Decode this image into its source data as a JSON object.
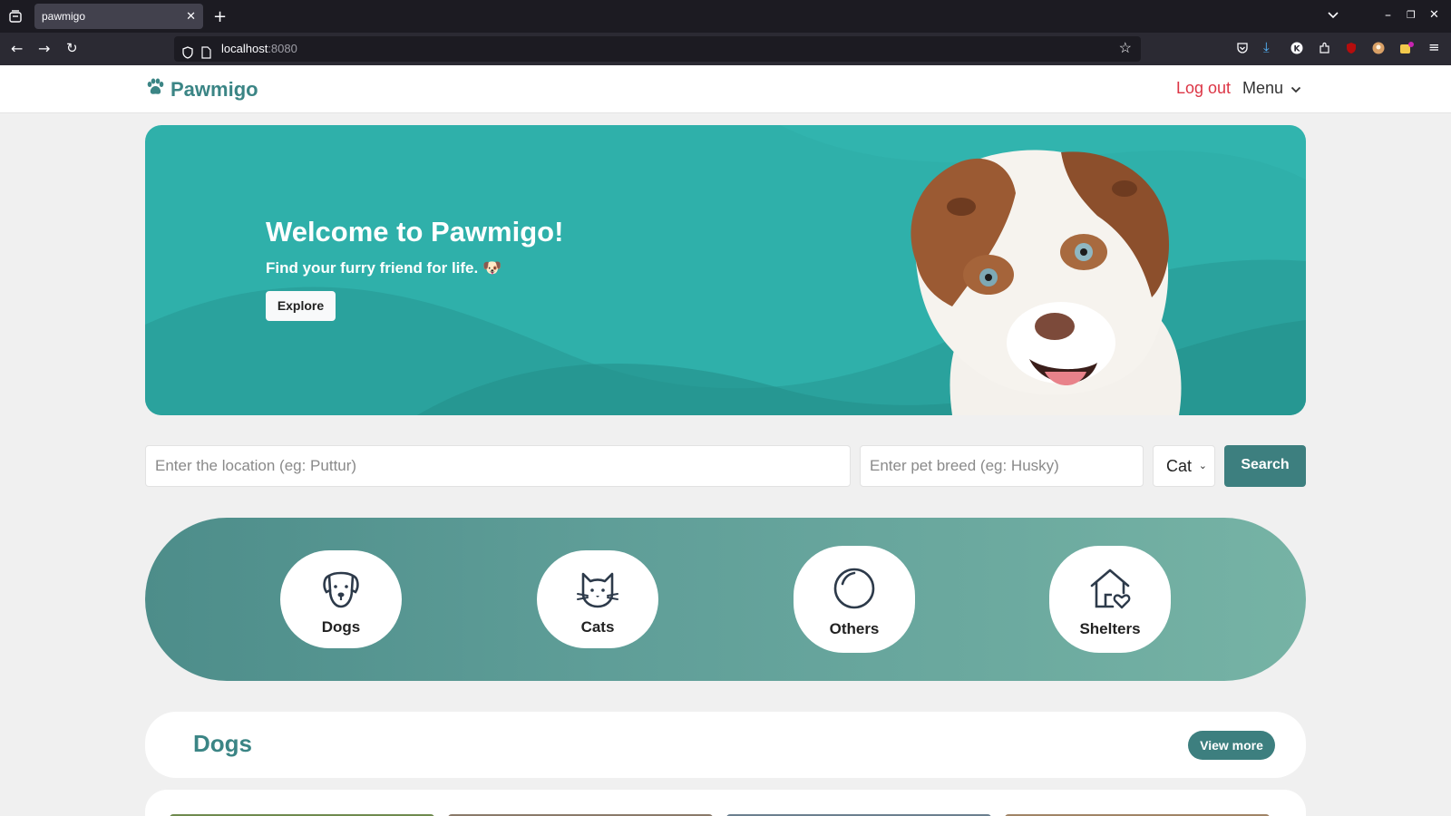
{
  "browser": {
    "tab_title": "pawmigo",
    "url_host": "localhost",
    "url_port": ":8080"
  },
  "header": {
    "brand": "Pawmigo",
    "logout": "Log out",
    "menu": "Menu"
  },
  "hero": {
    "title": "Welcome to Pawmigo!",
    "subtitle": "Find your furry friend for life. 🐶",
    "explore": "Explore"
  },
  "search": {
    "location_placeholder": "Enter the location (eg: Puttur)",
    "breed_placeholder": "Enter pet breed (eg: Husky)",
    "type_selected": "Cat",
    "button": "Search"
  },
  "categories": [
    {
      "label": "Dogs",
      "icon": "dog-icon"
    },
    {
      "label": "Cats",
      "icon": "cat-icon"
    },
    {
      "label": "Others",
      "icon": "circle-icon"
    },
    {
      "label": "Shelters",
      "icon": "house-heart-icon"
    }
  ],
  "dogs_section": {
    "title": "Dogs",
    "view_more": "View more"
  },
  "colors": {
    "brand": "#3b8585",
    "hero_teal": "#2fb0aa",
    "logout_red": "#dc3545",
    "button_teal": "#3d7f7f"
  }
}
